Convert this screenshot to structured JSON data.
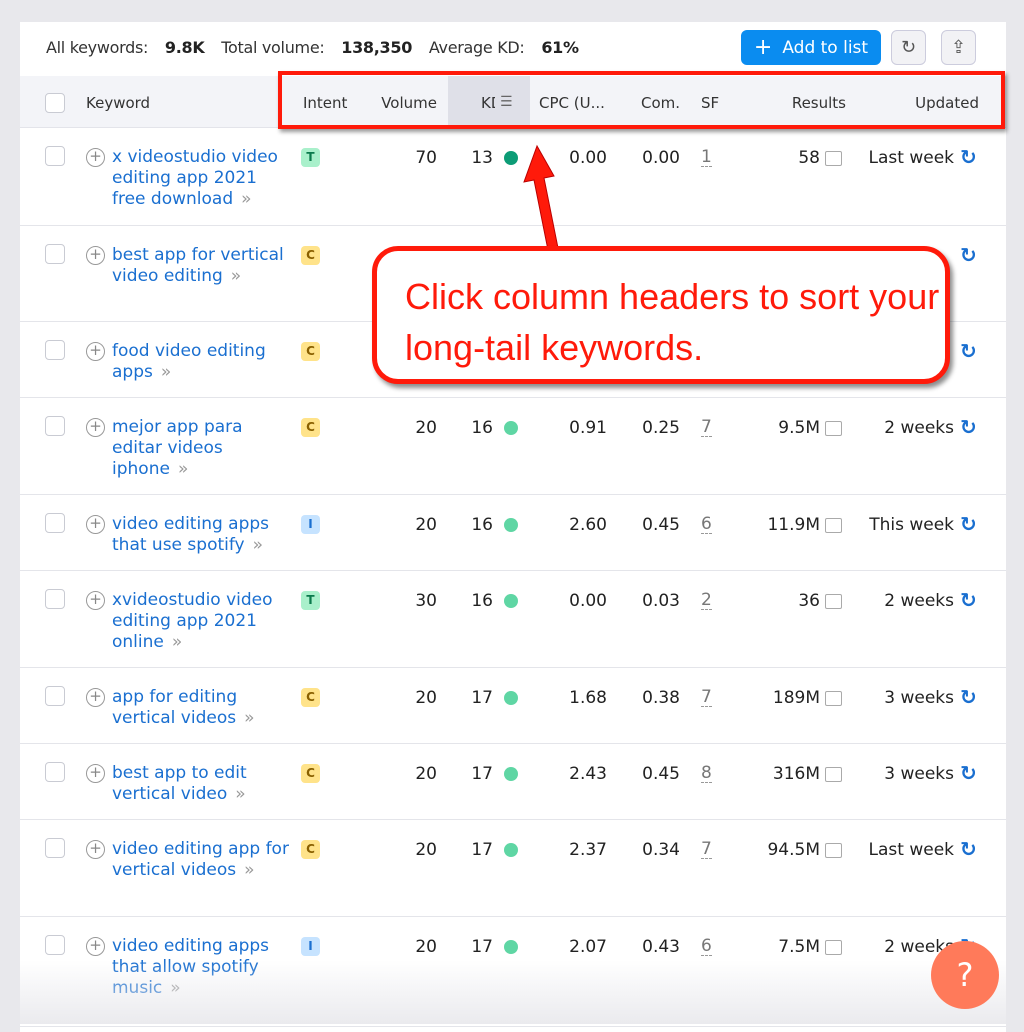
{
  "summary": {
    "all_keywords_label": "All keywords:",
    "all_keywords": "9.8K",
    "total_volume_label": "Total volume:",
    "total_volume": "138,350",
    "avg_kd_label": "Average KD:",
    "avg_kd": "61%"
  },
  "toolbar": {
    "add_label": "Add to list",
    "refresh_icon": "refresh-icon",
    "export_icon": "export-icon"
  },
  "columns": [
    "Keyword",
    "Intent",
    "Volume",
    "KD",
    "CPC (U...",
    "Com.",
    "SF",
    "Results",
    "Updated"
  ],
  "colors": {
    "accent": "#0a8cf0",
    "link": "#1a6fd0",
    "annotation": "#ff1a0a",
    "kd_dark": "#0d9c76",
    "kd_light": "#5fd6a4"
  },
  "rows": [
    {
      "keyword": "x videostudio video editing app 2021 free download",
      "intent": "T",
      "volume": "70",
      "kd": "13",
      "cpc": "0.00",
      "com": "0.00",
      "sf": "1",
      "results": "58",
      "updated": "Last week"
    },
    {
      "keyword": "best app for vertical video editing",
      "intent": "C",
      "volume": "",
      "kd": "",
      "cpc": "",
      "com": "",
      "sf": "",
      "results": "",
      "updated": ""
    },
    {
      "keyword": "food video editing apps",
      "intent": "C",
      "volume": "",
      "kd": "",
      "cpc": "",
      "com": "",
      "sf": "",
      "results": "",
      "updated": ""
    },
    {
      "keyword": "mejor app para editar videos iphone",
      "intent": "C",
      "volume": "20",
      "kd": "16",
      "cpc": "0.91",
      "com": "0.25",
      "sf": "7",
      "results": "9.5M",
      "updated": "2 weeks"
    },
    {
      "keyword": "video editing apps that use spotify",
      "intent": "I",
      "volume": "20",
      "kd": "16",
      "cpc": "2.60",
      "com": "0.45",
      "sf": "6",
      "results": "11.9M",
      "updated": "This week"
    },
    {
      "keyword": "xvideostudio video editing app 2021 online",
      "intent": "T",
      "volume": "30",
      "kd": "16",
      "cpc": "0.00",
      "com": "0.03",
      "sf": "2",
      "results": "36",
      "updated": "2 weeks"
    },
    {
      "keyword": "app for editing vertical videos",
      "intent": "C",
      "volume": "20",
      "kd": "17",
      "cpc": "1.68",
      "com": "0.38",
      "sf": "7",
      "results": "189M",
      "updated": "3 weeks"
    },
    {
      "keyword": "best app to edit vertical video",
      "intent": "C",
      "volume": "20",
      "kd": "17",
      "cpc": "2.43",
      "com": "0.45",
      "sf": "8",
      "results": "316M",
      "updated": "3 weeks"
    },
    {
      "keyword": "video editing app for vertical videos",
      "intent": "C",
      "volume": "20",
      "kd": "17",
      "cpc": "2.37",
      "com": "0.34",
      "sf": "7",
      "results": "94.5M",
      "updated": "Last week"
    },
    {
      "keyword": "video editing apps that allow spotify music",
      "intent": "I",
      "volume": "20",
      "kd": "17",
      "cpc": "2.07",
      "com": "0.43",
      "sf": "6",
      "results": "7.5M",
      "updated": "2 weeks"
    }
  ],
  "annotation": {
    "text": "Click column headers to sort your long-tail keywords."
  },
  "help": {
    "label": "?"
  }
}
